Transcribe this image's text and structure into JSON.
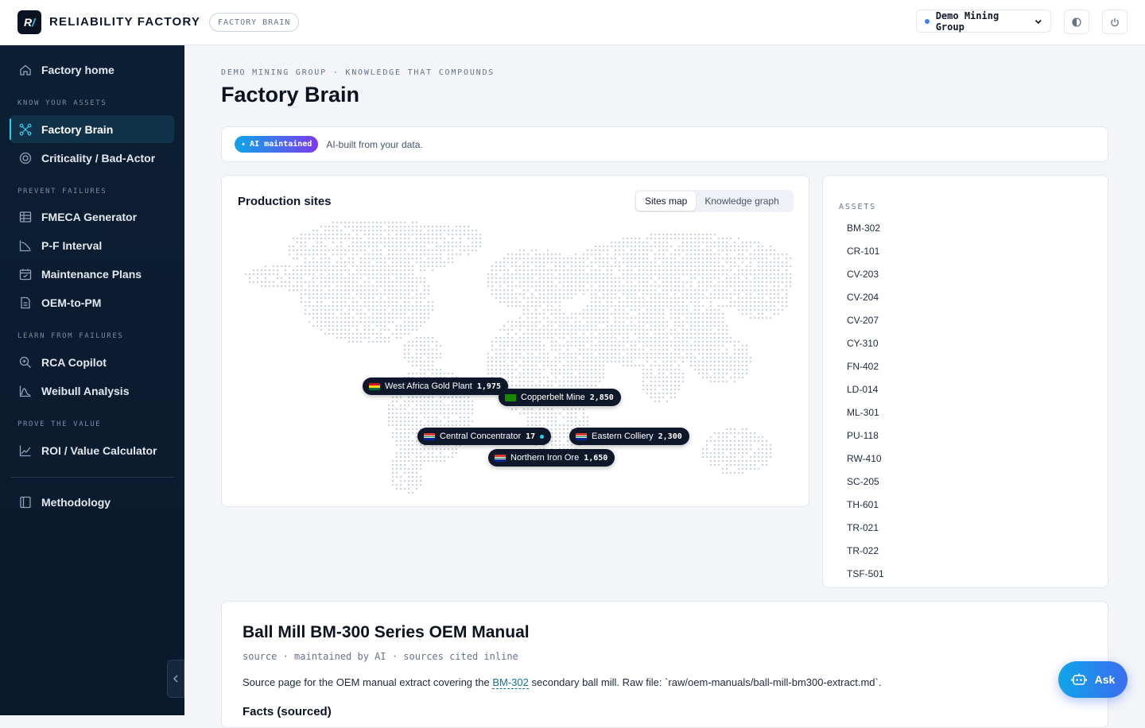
{
  "topbar": {
    "logo_text": "R/",
    "brand": "RELIABILITY FACTORY",
    "brand_pill": "FACTORY BRAIN",
    "org_select": "Demo Mining Group"
  },
  "sidebar": {
    "home": "Factory home",
    "sections": [
      {
        "label": "KNOW YOUR ASSETS",
        "items": [
          "Factory Brain",
          "Criticality / Bad-Actor"
        ]
      },
      {
        "label": "PREVENT FAILURES",
        "items": [
          "FMECA Generator",
          "P-F Interval",
          "Maintenance Plans",
          "OEM-to-PM"
        ]
      },
      {
        "label": "LEARN FROM FAILURES",
        "items": [
          "RCA Copilot",
          "Weibull Analysis"
        ]
      },
      {
        "label": "PROVE THE VALUE",
        "items": [
          "ROI / Value Calculator"
        ]
      }
    ],
    "methodology": "Methodology",
    "active": "Factory Brain"
  },
  "page": {
    "eyebrow": "DEMO MINING GROUP · KNOWLEDGE THAT COMPOUNDS",
    "title": "Factory Brain"
  },
  "banner": {
    "badge": "AI maintained",
    "text": "AI-built from your data."
  },
  "sites_card": {
    "title": "Production sites",
    "tabs": [
      "Sites map",
      "Knowledge graph"
    ],
    "active_tab": "Sites map",
    "sites": [
      {
        "name": "West Africa Gold Plant",
        "value": "1,975",
        "flag": "ghana"
      },
      {
        "name": "Copperbelt Mine",
        "value": "2,850",
        "flag": "zambia"
      },
      {
        "name": "Central Concentrator",
        "value": "17",
        "flag": "south-africa"
      },
      {
        "name": "Eastern Colliery",
        "value": "2,300",
        "flag": "south-africa"
      },
      {
        "name": "Northern Iron Ore",
        "value": "1,650",
        "flag": "south-africa"
      }
    ]
  },
  "assets": {
    "heading": "ASSETS",
    "items": [
      "BM-302",
      "CR-101",
      "CV-203",
      "CV-204",
      "CV-207",
      "CY-310",
      "FN-402",
      "LD-014",
      "ML-301",
      "PU-118",
      "RW-410",
      "SC-205",
      "TH-601",
      "TR-021",
      "TR-022",
      "TSF-501"
    ]
  },
  "doc": {
    "title": "Ball Mill BM-300 Series OEM Manual",
    "meta": "source · maintained by AI · sources cited inline",
    "body_prefix": "Source page for the OEM manual extract covering the ",
    "body_link": "BM-302",
    "body_suffix": " secondary ball mill. Raw file: `raw/oem-manuals/ball-mill-bm300-extract.md`.",
    "section_heading": "Facts (sourced)"
  },
  "ask_button": "Ask",
  "colors": {
    "sidebar_bg": "#0c1e33",
    "accent": "#22d3ee",
    "ai_badge_from": "#0ea5e9",
    "ai_badge_to": "#7c3aed"
  }
}
